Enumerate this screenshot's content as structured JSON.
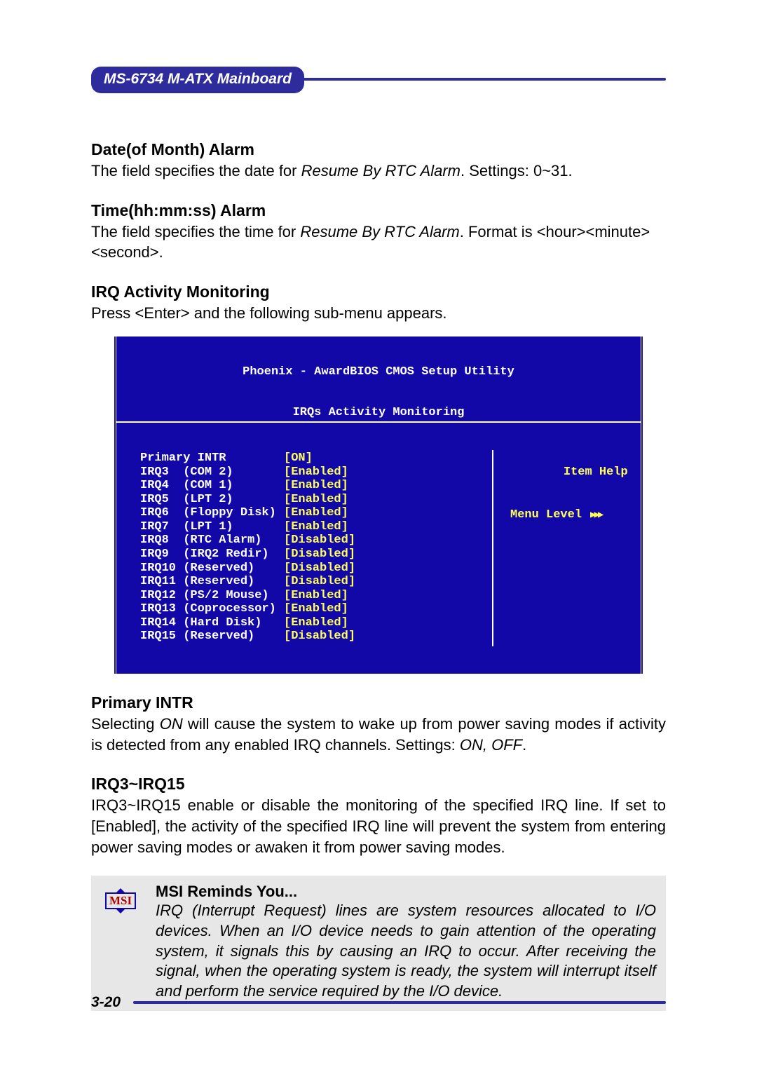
{
  "header": {
    "title": "MS-6734 M-ATX Mainboard"
  },
  "sections": {
    "dateAlarm": {
      "title": "Date(of Month) Alarm",
      "text_a": "The field specifies the date for ",
      "text_ital": "Resume By RTC Alarm",
      "text_b": ".  Settings: 0~31."
    },
    "timeAlarm": {
      "title": "Time(hh:mm:ss) Alarm",
      "text_a": "The field specifies the time for ",
      "text_ital": "Resume By RTC Alarm",
      "text_b": ".  Format is <hour><minute> <second>."
    },
    "irqMon": {
      "title": "IRQ Activity Monitoring",
      "text": "Press <Enter> and the following sub-menu appears."
    },
    "primaryIntr": {
      "title": "Primary INTR",
      "text_a": "Selecting ",
      "text_ital": "ON",
      "text_b": " will cause the system to wake up from power saving modes if activity is detected from any enabled IRQ channels.  Settings: ",
      "text_ital2": "ON, OFF",
      "text_c": "."
    },
    "irqRange": {
      "title": "IRQ3~IRQ15",
      "text": "IRQ3~IRQ15 enable or disable the monitoring of the specified IRQ line.  If set to [Enabled], the activity of the specified IRQ line will prevent the system from entering power saving modes or awaken it from power saving modes."
    }
  },
  "bios": {
    "title": "Phoenix - AwardBIOS CMOS Setup Utility",
    "subtitle": "IRQs Activity Monitoring",
    "help_title": "Item Help",
    "menu_level": "Menu Level",
    "rows": [
      {
        "label": "Primary INTR",
        "value": "[ON]"
      },
      {
        "label": "IRQ3  (COM 2)",
        "value": "[Enabled]"
      },
      {
        "label": "IRQ4  (COM 1)",
        "value": "[Enabled]"
      },
      {
        "label": "IRQ5  (LPT 2)",
        "value": "[Enabled]"
      },
      {
        "label": "IRQ6  (Floppy Disk)",
        "value": "[Enabled]"
      },
      {
        "label": "IRQ7  (LPT 1)",
        "value": "[Enabled]"
      },
      {
        "label": "IRQ8  (RTC Alarm)",
        "value": "[Disabled]"
      },
      {
        "label": "IRQ9  (IRQ2 Redir)",
        "value": "[Disabled]"
      },
      {
        "label": "IRQ10 (Reserved)",
        "value": "[Disabled]"
      },
      {
        "label": "IRQ11 (Reserved)",
        "value": "[Disabled]"
      },
      {
        "label": "IRQ12 (PS/2 Mouse)",
        "value": "[Enabled]"
      },
      {
        "label": "IRQ13 (Coprocessor)",
        "value": "[Enabled]"
      },
      {
        "label": "IRQ14 (Hard Disk)",
        "value": "[Enabled]"
      },
      {
        "label": "IRQ15 (Reserved)",
        "value": "[Disabled]"
      }
    ]
  },
  "reminder": {
    "logo": "MSI",
    "title": "MSI Reminds You...",
    "text": "IRQ (Interrupt Request) lines are system resources allocated to I/O devices. When an I/O device needs to gain attention of the operating system, it signals this by causing an IRQ to occur. After receiving the signal, when the operating system is ready, the system will interrupt itself and perform the service required by the I/O device."
  },
  "footer": {
    "page": "3-20"
  }
}
